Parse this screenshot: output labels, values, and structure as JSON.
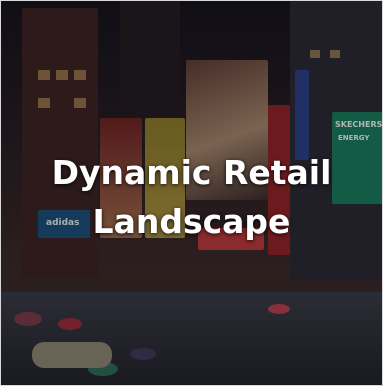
{
  "image": {
    "caption_line1": "Dynamic Retail",
    "caption_line2": "Landscape",
    "sign_brand": "SKECHERS",
    "sign_energy": "ENERGY",
    "sign_adidas": "adidas"
  },
  "colors": {
    "caption_text": "#ffffff",
    "skechers_sign": "#1b7a5e",
    "red_signs": "#c0242b",
    "blue_sign": "#2b3f86"
  }
}
